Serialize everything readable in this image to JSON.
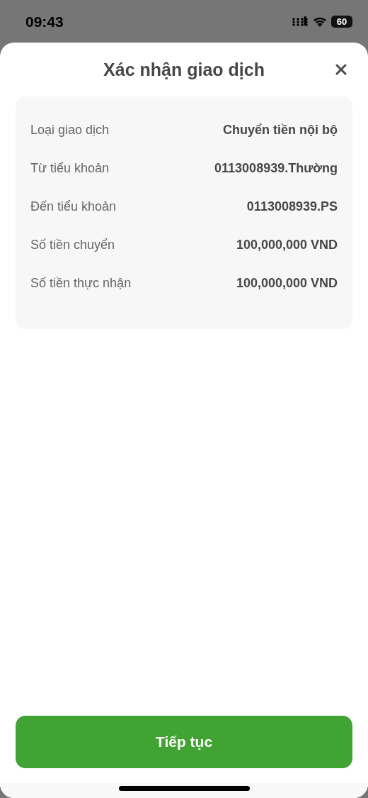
{
  "status_bar": {
    "time": "09:43",
    "battery": "60"
  },
  "sheet": {
    "title": "Xác nhận giao dịch"
  },
  "details": [
    {
      "label": "Loại giao dịch",
      "value": "Chuyển tiền nội bộ"
    },
    {
      "label": "Từ tiểu khoản",
      "value": "0113008939.Thường"
    },
    {
      "label": "Đến tiểu khoản",
      "value": "0113008939.PS"
    },
    {
      "label": "Số tiền chuyển",
      "value": "100,000,000 VND"
    },
    {
      "label": "Số tiền thực nhận",
      "value": "100,000,000 VND"
    }
  ],
  "primary_button": "Tiếp tục"
}
